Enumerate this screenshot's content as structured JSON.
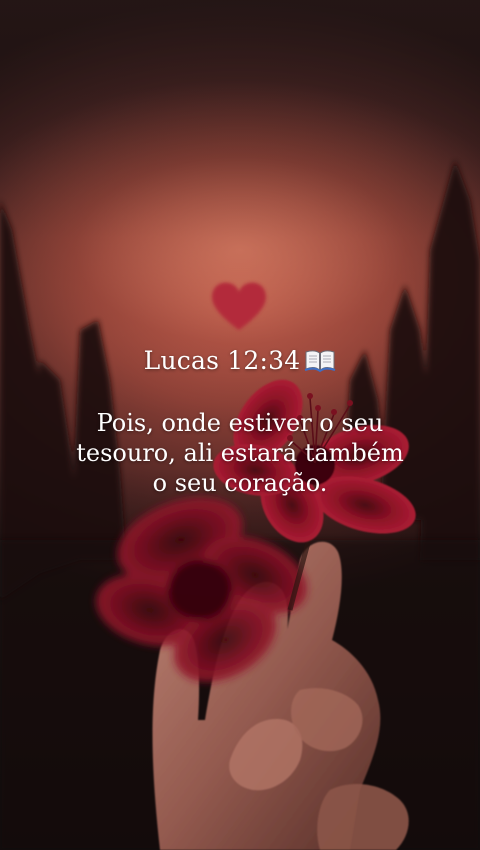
{
  "post": {
    "reference": "Lucas 12:34",
    "reference_icon": "open-book-icon",
    "verse_lines": [
      "Pois, onde estiver o seu",
      "tesouro, ali estará também",
      "o seu coração."
    ]
  },
  "colors": {
    "text": "#ffffff",
    "petal": "#a3162e",
    "heart": "#b32a3a"
  }
}
